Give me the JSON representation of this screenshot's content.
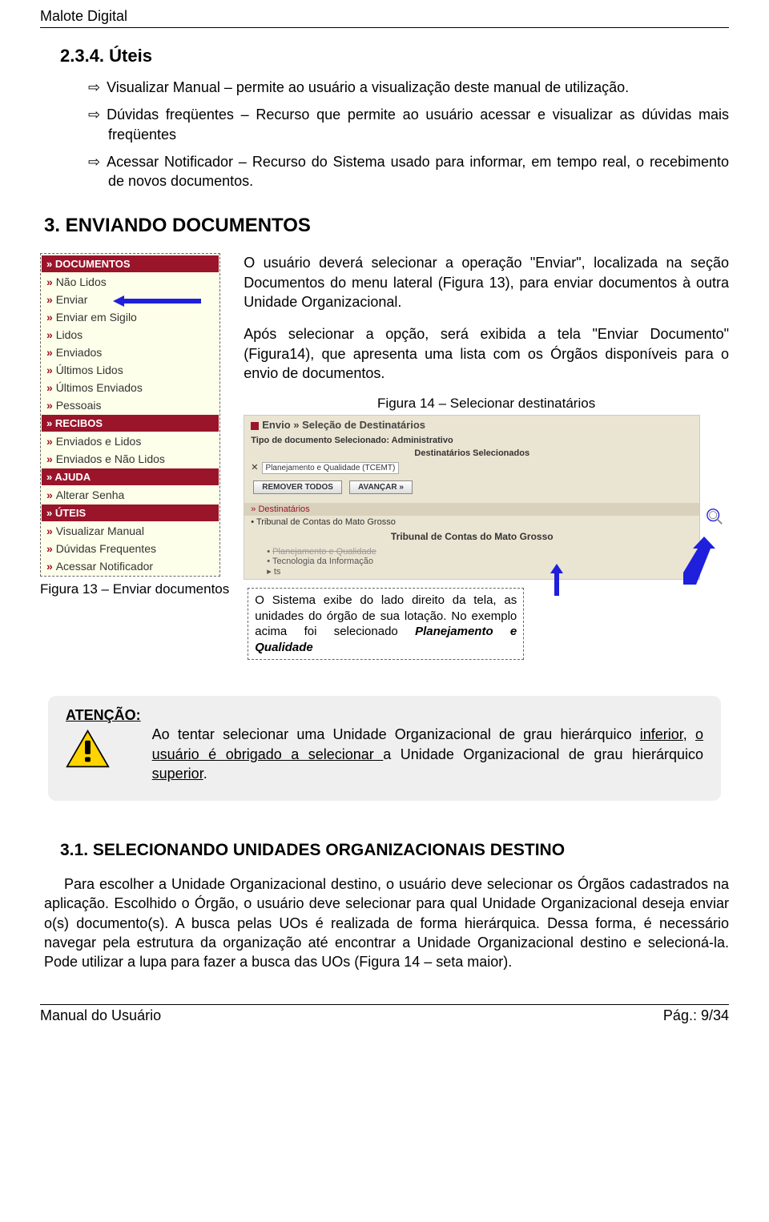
{
  "header": {
    "title": "Malote Digital"
  },
  "sec234": {
    "heading": "2.3.4. Úteis",
    "p1": "Visualizar Manual – permite ao usuário a visualização deste manual de utilização.",
    "p2": "Dúvidas freqüentes – Recurso que  permite ao usuário acessar e visualizar as dúvidas mais freqüentes",
    "p3": "Acessar Notificador – Recurso do Sistema usado para informar, em tempo real, o recebimento de novos documentos."
  },
  "sec3": {
    "heading": "3. ENVIANDO DOCUMENTOS",
    "p1": "O usuário deverá selecionar a operação \"Enviar\", localizada na seção Documentos do menu lateral (Figura 13), para enviar documentos à outra Unidade Organizacional.",
    "p2": "Após selecionar a opção, será exibida a tela \"Enviar Documento\" (Figura14), que apresenta uma lista com os Órgãos disponíveis para o envio de documentos.",
    "fig14_caption": "Figura 14 – Selecionar destinatários",
    "fig13_caption": "Figura 13 – Enviar documentos",
    "caption_box_prefix": "O Sistema exibe do lado direito da tela, as unidades do órgão de sua lotação. No exemplo acima foi selecionado ",
    "caption_box_bold": "Planejamento e Qualidade"
  },
  "sidebar": {
    "cat1": "DOCUMENTOS",
    "items1": [
      "Não Lidos",
      "Enviar",
      "Enviar em Sigilo",
      "Lidos",
      "Enviados",
      "Últimos Lidos",
      "Últimos Enviados",
      "Pessoais"
    ],
    "cat2": "RECIBOS",
    "items2": [
      "Enviados e Lidos",
      "Enviados e Não Lidos"
    ],
    "cat3": "AJUDA",
    "items3": [
      "Alterar Senha"
    ],
    "cat4": "ÚTEIS",
    "items4": [
      "Visualizar Manual",
      "Dúvidas Frequentes",
      "Acessar Notificador"
    ]
  },
  "fig14": {
    "title": "Envio » Seleção de Destinatários",
    "tipo": "Tipo de documento Selecionado: Administrativo",
    "dest_sel": "Destinatários Selecionados",
    "cell1": "Planejamento e Qualidade (TCEMT)",
    "btn1": "REMOVER TODOS",
    "btn2": "AVANÇAR »",
    "sub2": "Destinatários",
    "trib_item": "Tribunal de Contas do Mato Grosso",
    "trib_bold": "Tribunal de Contas do Mato Grosso",
    "sub_items": [
      "Planejamento e Qualidade",
      "Tecnologia da Informação",
      "ts"
    ]
  },
  "atencao": {
    "label": "ATENÇÃO:",
    "t1": "Ao tentar selecionar uma Unidade Organizacional de grau hierárquico ",
    "u1": "inferior",
    "t2": ", ",
    "u2": "o usuário é obrigado a selecionar ",
    "t3": "a Unidade Organizacional de grau hierárquico ",
    "u3": "superior",
    "t4": "."
  },
  "sec31": {
    "heading": "3.1. SELECIONANDO UNIDADES ORGANIZACIONAIS DESTINO",
    "body": "Para escolher a Unidade Organizacional destino, o usuário deve selecionar os Órgãos cadastrados na aplicação. Escolhido o Órgão, o usuário deve selecionar para qual Unidade Organizacional deseja enviar o(s) documento(s).  A busca pelas UOs é realizada de forma hierárquica.  Dessa forma, é necessário navegar pela estrutura da organização até encontrar a Unidade Organizacional destino e selecioná-la.  Pode utilizar a lupa para fazer a busca das UOs (Figura 14 – seta maior)."
  },
  "footer": {
    "left": "Manual do Usuário",
    "right": "Pág.: 9/34"
  }
}
